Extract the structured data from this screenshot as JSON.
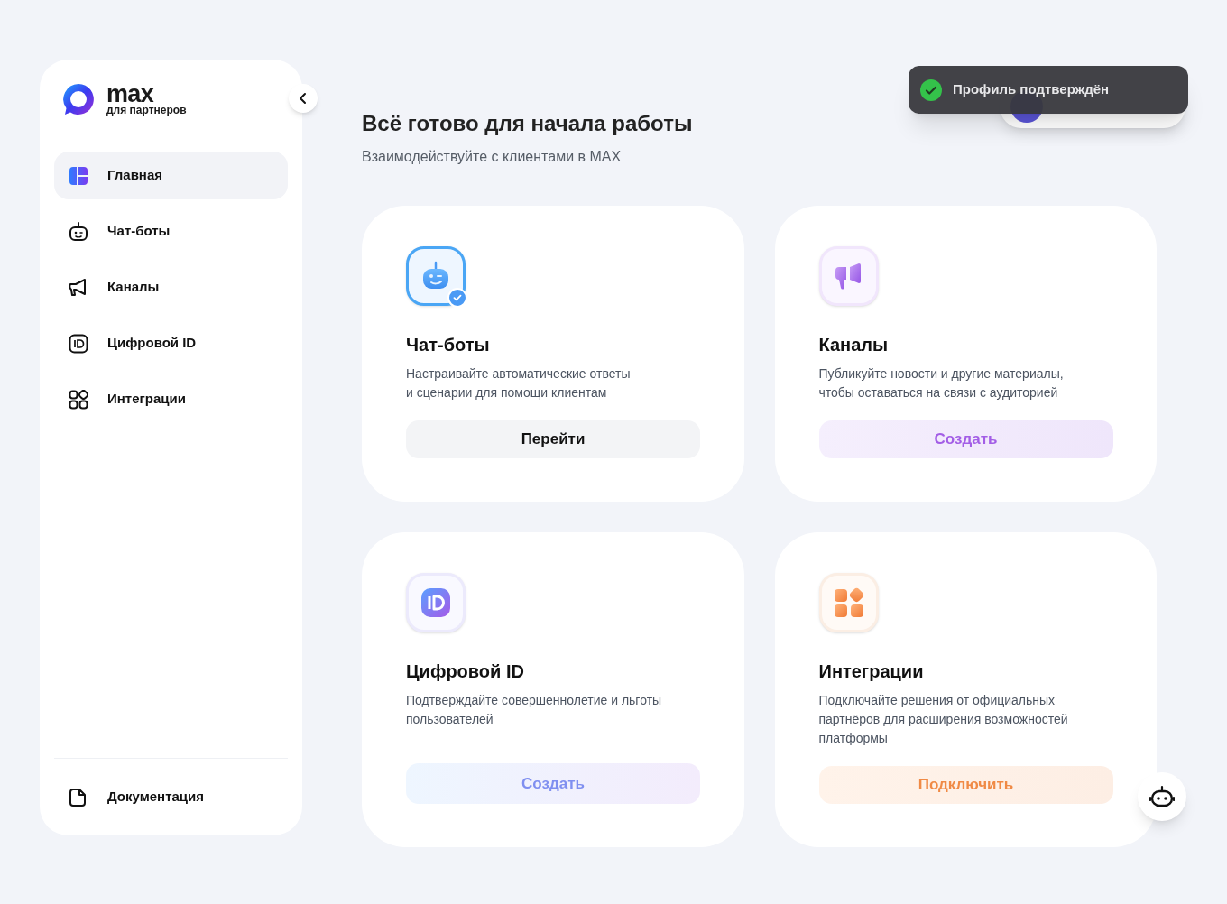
{
  "logo": {
    "name": "max",
    "tagline": "для партнеров"
  },
  "sidebar": {
    "items": [
      {
        "kind": "home",
        "label": "Главная",
        "selected": true
      },
      {
        "kind": "bot",
        "label": "Чат-боты",
        "selected": false
      },
      {
        "kind": "megaphone",
        "label": "Каналы",
        "selected": false
      },
      {
        "kind": "id",
        "label": "Цифровой ID",
        "selected": false
      },
      {
        "kind": "apps",
        "label": "Интеграции",
        "selected": false
      }
    ],
    "footer_item": {
      "kind": "doc",
      "label": "Документация",
      "selected": false
    }
  },
  "header": {
    "title": "Всё готово для начала работы",
    "subtitle": "Взаимодействуйте с клиентами в MAX"
  },
  "cards": [
    {
      "kind": "bot",
      "title": "Чат-боты",
      "description": "Настраивайте автоматические ответы\nи сценарии для помощи клиентам",
      "button": "Перейти",
      "verified": true
    },
    {
      "kind": "megaphone",
      "title": "Каналы",
      "description": "Публикуйте новости и другие материалы,\nчтобы оставаться на связи с аудиторией",
      "button": "Создать",
      "verified": false
    },
    {
      "kind": "id",
      "title": "Цифровой ID",
      "description": "Подтверждайте совершеннолетие и льготы\nпользователей",
      "button": "Создать",
      "verified": false
    },
    {
      "kind": "apps",
      "title": "Интеграции",
      "description": "Подключайте решения от официальных\nпартнёров для расширения возможностей\nплатформы",
      "button": "Подключить",
      "verified": false
    }
  ],
  "toast": {
    "text": "Профиль подтверждён"
  }
}
